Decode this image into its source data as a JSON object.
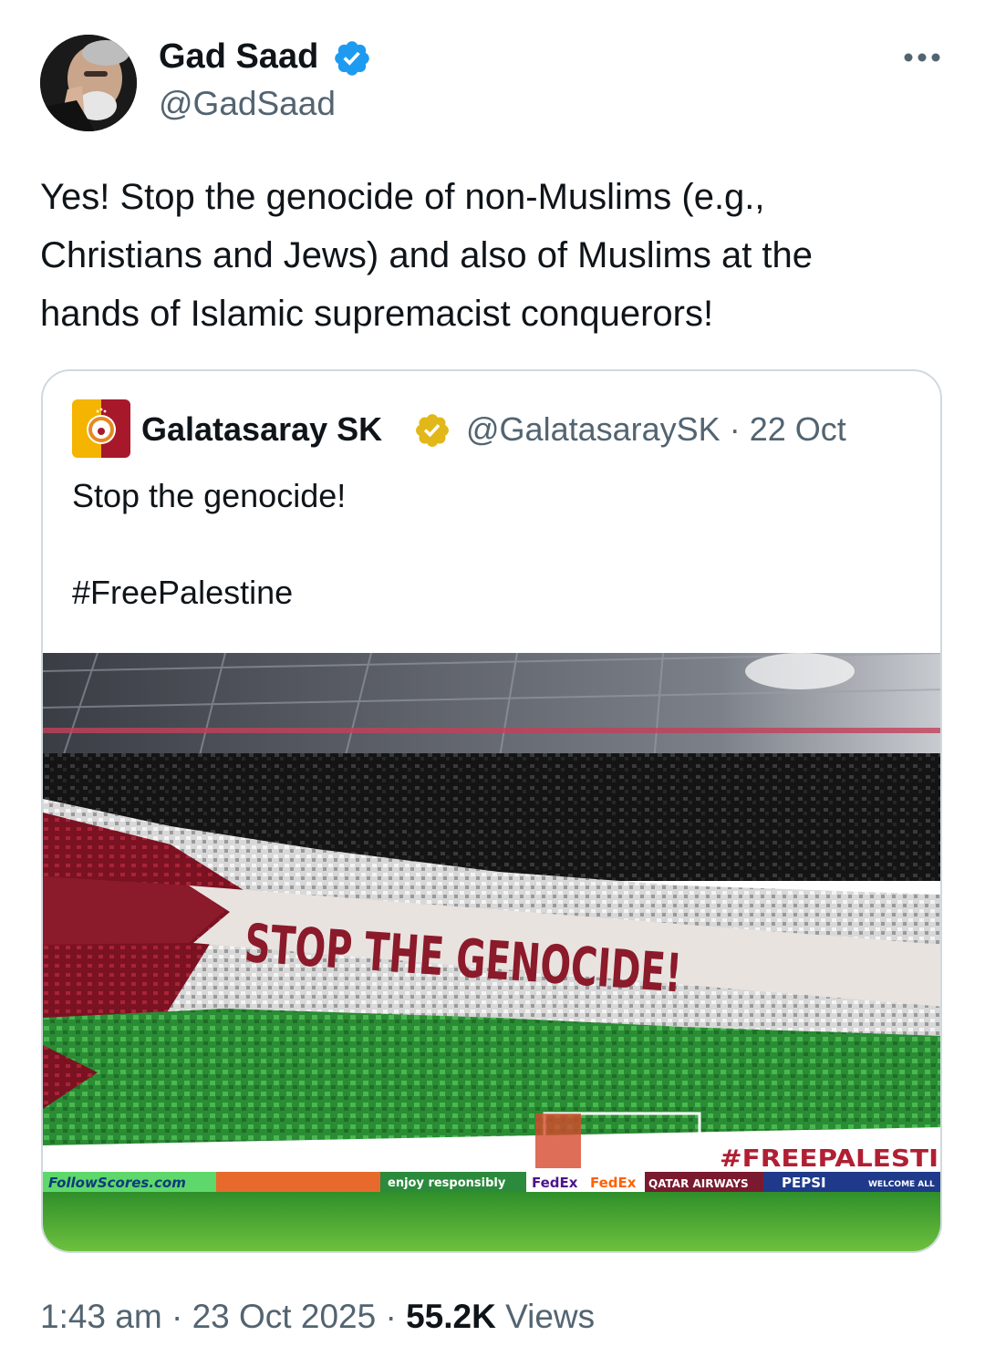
{
  "tweet": {
    "author": {
      "name": "Gad Saad",
      "handle": "@GadSaad"
    },
    "text": "Yes!  Stop the genocide of non-Muslims (e.g.,\nChristians and Jews) and also of Muslims at the\nhands of Islamic supremacist conquerors!",
    "time": "1:43 am",
    "date": "23 Oct 2025",
    "views_count": "55.2K",
    "views_label": "Views",
    "separator": "·"
  },
  "quote": {
    "author": {
      "name": "Galatasaray SK",
      "handle": "@GalatasaraySK"
    },
    "date": "22 Oct",
    "text": "Stop the genocide!\n\n#FreePalestine",
    "image": {
      "banner_text": "STOP THE GENOCIDE!",
      "hashtag_banner": "#FREEPALESTI",
      "ad_boards": [
        "FollowScores.com",
        "enjoy responsibly",
        "FedEx",
        "FedEx",
        "QATAR AIRWAYS",
        "PEPSI",
        "WELCOME ALL"
      ]
    }
  },
  "icons": {
    "verified": "verified-badge-icon",
    "org_verified": "gold-verified-badge-icon",
    "more": "more-icon"
  },
  "colors": {
    "verified_blue": "#1d9bf0",
    "gold": "#e2b719",
    "secondary_text": "#536471",
    "border": "#cfd9de",
    "banner_red": "#8b1a2a",
    "palestine_green": "#2f9e3a"
  }
}
